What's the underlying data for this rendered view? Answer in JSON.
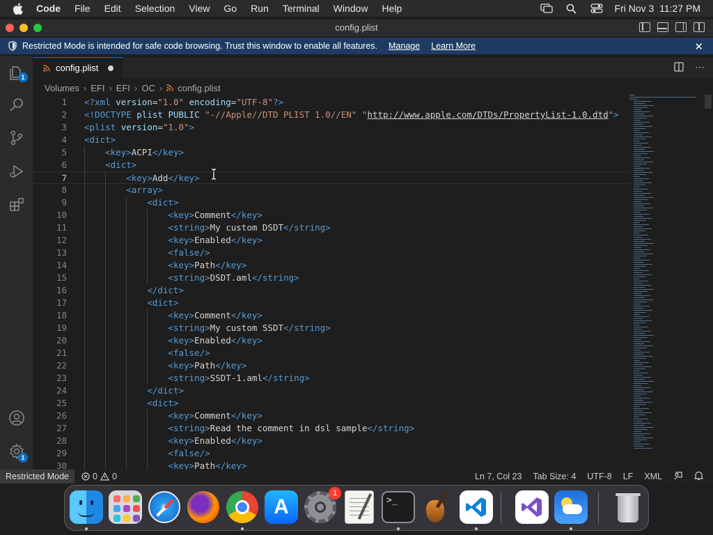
{
  "menubar": {
    "app_name": "Code",
    "menus": [
      "File",
      "Edit",
      "Selection",
      "View",
      "Go",
      "Run",
      "Terminal",
      "Window",
      "Help"
    ],
    "clock": "Fri Nov 3  11:27 PM"
  },
  "window": {
    "title": "config.plist"
  },
  "banner": {
    "message": "Restricted Mode is intended for safe code browsing. Trust this window to enable all features.",
    "manage_link": "Manage",
    "learn_more_link": "Learn More"
  },
  "activity_bar": {
    "explorer_badge": "1",
    "settings_badge": "1"
  },
  "tab": {
    "label": "config.plist"
  },
  "breadcrumb": [
    "Volumes",
    "EFI",
    "EFI",
    "OC",
    "config.plist"
  ],
  "editor": {
    "current_line": 7,
    "lines": [
      {
        "n": "1",
        "code": "<?xml version=\"1.0\" encoding=\"UTF-8\"?>"
      },
      {
        "n": "2",
        "code": "<!DOCTYPE plist PUBLIC \"-//Apple//DTD PLIST 1.0//EN\" \"http://www.apple.com/DTDs/PropertyList-1.0.dtd\">"
      },
      {
        "n": "3",
        "code": "<plist version=\"1.0\">"
      },
      {
        "n": "4",
        "code": "<dict>"
      },
      {
        "n": "5",
        "code": "    <key>ACPI</key>"
      },
      {
        "n": "6",
        "code": "    <dict>"
      },
      {
        "n": "7",
        "code": "        <key>Add</key>"
      },
      {
        "n": "8",
        "code": "        <array>"
      },
      {
        "n": "9",
        "code": "            <dict>"
      },
      {
        "n": "10",
        "code": "                <key>Comment</key>"
      },
      {
        "n": "11",
        "code": "                <string>My custom DSDT</string>"
      },
      {
        "n": "12",
        "code": "                <key>Enabled</key>"
      },
      {
        "n": "13",
        "code": "                <false/>"
      },
      {
        "n": "14",
        "code": "                <key>Path</key>"
      },
      {
        "n": "15",
        "code": "                <string>DSDT.aml</string>"
      },
      {
        "n": "16",
        "code": "            </dict>"
      },
      {
        "n": "17",
        "code": "            <dict>"
      },
      {
        "n": "18",
        "code": "                <key>Comment</key>"
      },
      {
        "n": "19",
        "code": "                <string>My custom SSDT</string>"
      },
      {
        "n": "20",
        "code": "                <key>Enabled</key>"
      },
      {
        "n": "21",
        "code": "                <false/>"
      },
      {
        "n": "22",
        "code": "                <key>Path</key>"
      },
      {
        "n": "23",
        "code": "                <string>SSDT-1.aml</string>"
      },
      {
        "n": "24",
        "code": "            </dict>"
      },
      {
        "n": "25",
        "code": "            <dict>"
      },
      {
        "n": "26",
        "code": "                <key>Comment</key>"
      },
      {
        "n": "27",
        "code": "                <string>Read the comment in dsl sample</string>"
      },
      {
        "n": "28",
        "code": "                <key>Enabled</key>"
      },
      {
        "n": "29",
        "code": "                <false/>"
      },
      {
        "n": "30",
        "code": "                <key>Path</key>"
      }
    ]
  },
  "statusbar": {
    "restricted_label": "Restricted Mode",
    "errors": "0",
    "warnings": "0",
    "position": "Ln 7, Col 23",
    "tab_size": "Tab Size: 4",
    "encoding": "UTF-8",
    "eol": "LF",
    "language": "XML"
  },
  "dock": {
    "apps": [
      {
        "name": "Finder",
        "icon": "finder-icon",
        "running": true
      },
      {
        "name": "Launchpad",
        "icon": "launchpad-icon",
        "running": false
      },
      {
        "name": "Safari",
        "icon": "safari-icon",
        "running": false
      },
      {
        "name": "Firefox",
        "icon": "firefox-icon",
        "running": false
      },
      {
        "name": "Chrome",
        "icon": "chrome-icon",
        "running": true
      },
      {
        "name": "App Store",
        "icon": "app-store-icon",
        "running": false
      },
      {
        "name": "System Settings",
        "icon": "system-settings-icon",
        "running": false,
        "badge": "1"
      },
      {
        "name": "TextEdit",
        "icon": "textedit-icon",
        "running": false
      },
      {
        "name": "Terminal",
        "icon": "terminal-icon",
        "running": true
      },
      {
        "name": "Instruments",
        "icon": "instruments-icon",
        "running": false
      },
      {
        "name": "Visual Studio Code",
        "icon": "vscode-icon",
        "running": true
      },
      {
        "name": "Visual Studio",
        "icon": "visual-studio-icon",
        "running": false
      },
      {
        "name": "Weather",
        "icon": "weather-icon",
        "running": true
      },
      {
        "name": "Trash",
        "icon": "trash-icon",
        "running": false
      }
    ]
  },
  "colors": {
    "accent": "#0078d4",
    "banner": "#1e3b63",
    "xml_tag": "#569cd6",
    "xml_attr": "#9cdcfe",
    "xml_string": "#ce9178"
  }
}
